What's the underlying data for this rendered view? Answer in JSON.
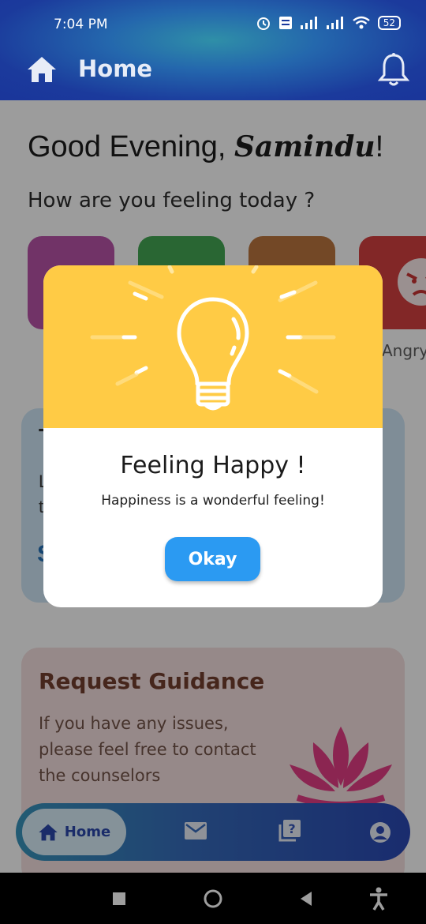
{
  "status_bar": {
    "time": "7:04 PM",
    "battery": "52",
    "icons": [
      "alarm-icon",
      "volte-icon",
      "signal-icon",
      "signal-icon",
      "wifi-icon",
      "battery-icon"
    ]
  },
  "app_bar": {
    "title": "Home",
    "left_icon": "home-icon",
    "right_icon": "bell-icon"
  },
  "greeting": {
    "prefix": "Good Evening, ",
    "name": "Samindu",
    "suffix": "!"
  },
  "feeling_question": "How are you feeling today ?",
  "moods": [
    {
      "color": "#b54aa4",
      "label": ""
    },
    {
      "color": "#3aa34a",
      "label": ""
    },
    {
      "color": "#b86e34",
      "label": ""
    },
    {
      "color": "#d33636",
      "label": "Angry"
    }
  ],
  "tips_card": {
    "line1": "T",
    "line2": "L",
    "line3": "t",
    "line4": "S"
  },
  "guidance_card": {
    "title": "Request Guidance",
    "text": "If you have any issues, please feel free to contact the counselors"
  },
  "bottom_nav": {
    "active_label": "Home",
    "items": [
      "home-icon",
      "mail-icon",
      "question-icon",
      "account-icon"
    ]
  },
  "dialog": {
    "title": "Feeling Happy !",
    "message": "Happiness is a wonderful feeling!",
    "button_label": "Okay",
    "hero_color": "#ffcb45"
  },
  "colors": {
    "app_bar": "#1b3a9c",
    "button": "#2b9af2"
  }
}
